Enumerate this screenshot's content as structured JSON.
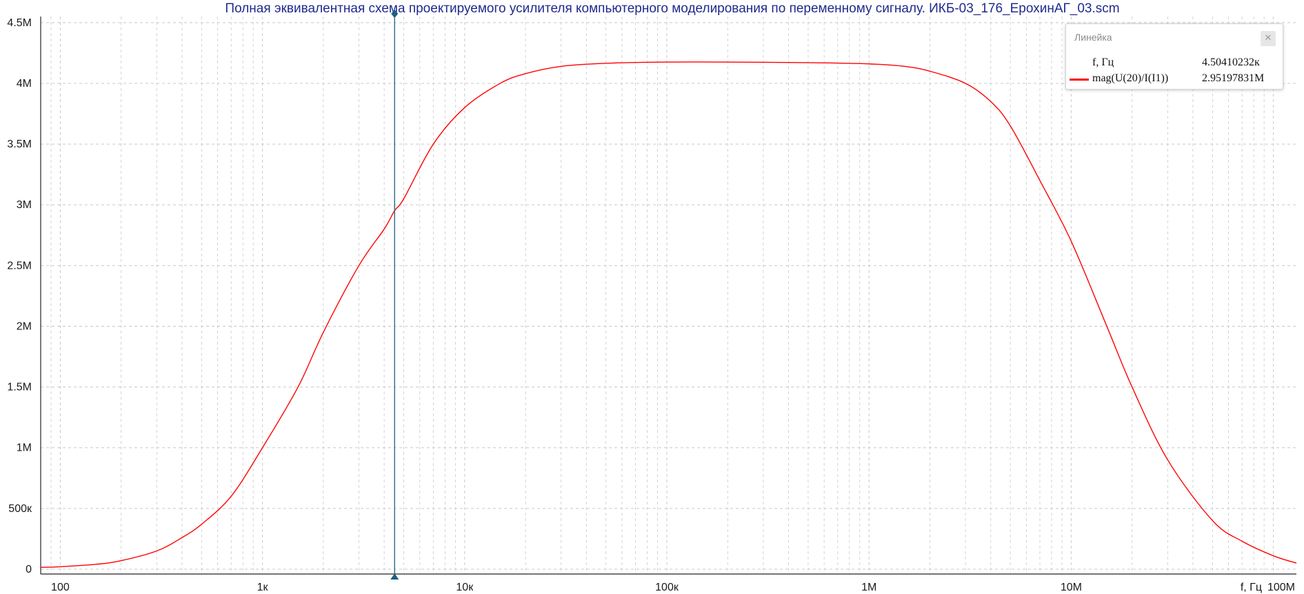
{
  "colors": {
    "curve": "#ff0000",
    "cursor": "#1d5f80",
    "title": "#1f2a8c",
    "grid": "#c8c8c8",
    "axis": "#222222"
  },
  "chart_data": {
    "type": "line",
    "title": "Полная эквивалентная схема проектируемого усилителя компьютерного моделирования по переменному сигналу. ИКБ-03_176_ЕрохинАГ_03.scm",
    "xlabel": "f, Гц",
    "ylabel": "",
    "x_scale": "log",
    "xlim": [
      80,
      130000000
    ],
    "ylim": [
      -40000,
      4550000
    ],
    "grid": true,
    "x_ticks": [
      {
        "value": 100,
        "label": "100"
      },
      {
        "value": 1000,
        "label": "1к"
      },
      {
        "value": 10000,
        "label": "10к"
      },
      {
        "value": 100000,
        "label": "100к"
      },
      {
        "value": 1000000,
        "label": "1M"
      },
      {
        "value": 10000000,
        "label": "10M"
      },
      {
        "value": 100000000,
        "label": "100M"
      }
    ],
    "y_ticks": [
      {
        "value": 0,
        "label": "0"
      },
      {
        "value": 500000,
        "label": "500к"
      },
      {
        "value": 1000000,
        "label": "1M"
      },
      {
        "value": 1500000,
        "label": "1.5M"
      },
      {
        "value": 2000000,
        "label": "2M"
      },
      {
        "value": 2500000,
        "label": "2.5M"
      },
      {
        "value": 3000000,
        "label": "3M"
      },
      {
        "value": 3500000,
        "label": "3.5M"
      },
      {
        "value": 4000000,
        "label": "4M"
      },
      {
        "value": 4500000,
        "label": "4.5M"
      }
    ],
    "series": [
      {
        "name": "mag(U(20)/I(I1))",
        "color": "#ff0000",
        "x": [
          80,
          100,
          150,
          200,
          300,
          400,
          500,
          700,
          1000,
          1500,
          2000,
          3000,
          4000,
          4504,
          5000,
          7000,
          10000,
          15000,
          20000,
          30000,
          50000,
          100000,
          200000,
          500000,
          1000000,
          1500000,
          2000000,
          3000000,
          4000000,
          5000000,
          7000000,
          10000000,
          15000000,
          20000000,
          30000000,
          50000000,
          70000000,
          100000000,
          130000000
        ],
        "y": [
          15000,
          20000,
          40000,
          70000,
          150000,
          260000,
          370000,
          600000,
          1000000,
          1500000,
          1950000,
          2500000,
          2800000,
          2952000,
          3050000,
          3500000,
          3800000,
          4000000,
          4080000,
          4140000,
          4165000,
          4175000,
          4175000,
          4170000,
          4160000,
          4140000,
          4100000,
          4000000,
          3850000,
          3650000,
          3200000,
          2700000,
          2000000,
          1500000,
          900000,
          400000,
          230000,
          110000,
          50000
        ]
      }
    ],
    "cursor": {
      "x": 4504.10232
    }
  },
  "ruler": {
    "title": "Линейка",
    "close_icon": "close-icon",
    "rows": [
      {
        "name": "f, Гц",
        "value": "4.50410232к"
      },
      {
        "name": "mag(U(20)/I(I1))",
        "value": "2.95197831M"
      }
    ]
  }
}
